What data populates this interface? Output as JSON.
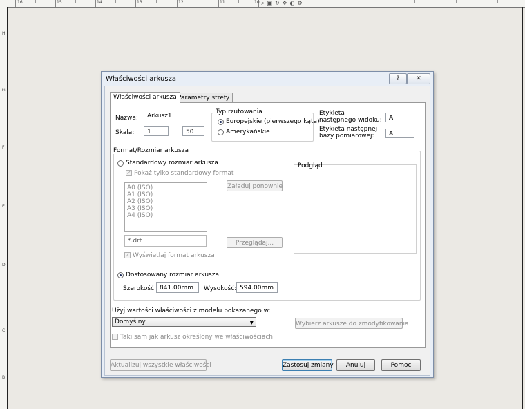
{
  "ruler": {
    "top_numbers": [
      "16",
      "15",
      "14",
      "13",
      "12",
      "11",
      "10"
    ],
    "left_letters": [
      "H",
      "G",
      "F",
      "E",
      "D",
      "C",
      "B"
    ]
  },
  "dialog": {
    "title": "Właściwości arkusza",
    "help_glyph": "?",
    "close_glyph": "✕",
    "tabs": [
      "Właściwości arkusza",
      "Parametry strefy"
    ],
    "name_label": "Nazwa:",
    "name_value": "Arkusz1",
    "scale_label": "Skala:",
    "scale_num": "1",
    "scale_sep": ":",
    "scale_den": "50",
    "projection": {
      "title": "Typ rzutowania",
      "options": [
        "Europejskie (pierwszego kąta)",
        "Amerykańskie"
      ],
      "selected": "Europejskie (pierwszego kąta)"
    },
    "next_view_label": "Etykieta następnego widoku:",
    "next_view_value": "A",
    "next_datum_label": "Etykieta następnej bazy pomiarowej:",
    "next_datum_value": "A",
    "format": {
      "title": "Format/Rozmiar arkusza",
      "standard_label": "Standardowy rozmiar arkusza",
      "show_standard_only": "Pokaż tylko standardowy format",
      "sizes": [
        "A0 (ISO)",
        "A1 (ISO)",
        "A2 (ISO)",
        "A3 (ISO)",
        "A4 (ISO)"
      ],
      "reload_button": "Załaduj ponownie",
      "file_value": "*.drt",
      "browse_button": "Przeglądaj...",
      "display_format": "Wyświetlaj format arkusza",
      "custom_label": "Dostosowany rozmiar arkusza",
      "width_label": "Szerokość:",
      "width_value": "841.00mm",
      "height_label": "Wysokość:",
      "height_value": "594.00mm",
      "preview_title": "Podgląd"
    },
    "model_label": "Użyj wartości właściwości z modelu pokazanego w:",
    "model_combo": "Domyślny",
    "select_sheets_button": "Wybierz arkusze do zmodyfikowania",
    "same_sheet_label": "Taki sam jak arkusz określony we właściwościach",
    "update_all_button": "Aktualizuj wszystkie właściwości",
    "apply_button": "Zastosuj zmiany",
    "cancel_button": "Anuluj",
    "help_button": "Pomoc"
  }
}
